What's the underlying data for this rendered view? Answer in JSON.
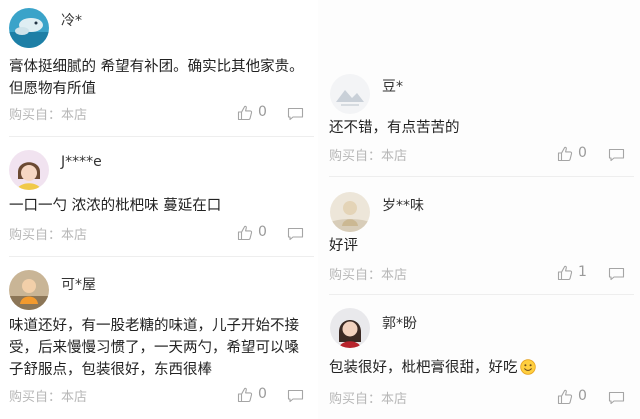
{
  "reviews_left": [
    {
      "username": "冷*",
      "content": "膏体挺细腻的 希望有补团。确实比其他家贵。但愿物有所值",
      "source": "购买自：本店",
      "likes": "0"
    },
    {
      "username": "J****e",
      "content": "一口一勺 浓浓的枇杷味 蔓延在口",
      "source": "购买自：本店",
      "likes": "0"
    },
    {
      "username": "可*屋",
      "content": "味道还好，有一股老糖的味道，儿子开始不接受，后来慢慢习惯了，一天两勺，希望可以嗓子舒服点，包装很好，东西很棒",
      "source": "购买自：本店",
      "likes": "0"
    }
  ],
  "reviews_right": [
    {
      "username": "豆*",
      "content": "还不错，有点苦苦的",
      "source": "购买自：本店",
      "likes": "0"
    },
    {
      "username": "岁**味",
      "content": "好评",
      "source": "购买自：本店",
      "likes": "1"
    },
    {
      "username": "郭*盼",
      "content": "包装很好，枇杷膏很甜，好吃",
      "source": "购买自：本店",
      "likes": "0"
    }
  ],
  "icons": {
    "like": "thumbs-up-icon",
    "comment": "comment-icon",
    "emoji": "smiley-emoji-icon"
  },
  "colors": {
    "meta_text": "#b7b7b7",
    "divider": "#eeeeee"
  }
}
